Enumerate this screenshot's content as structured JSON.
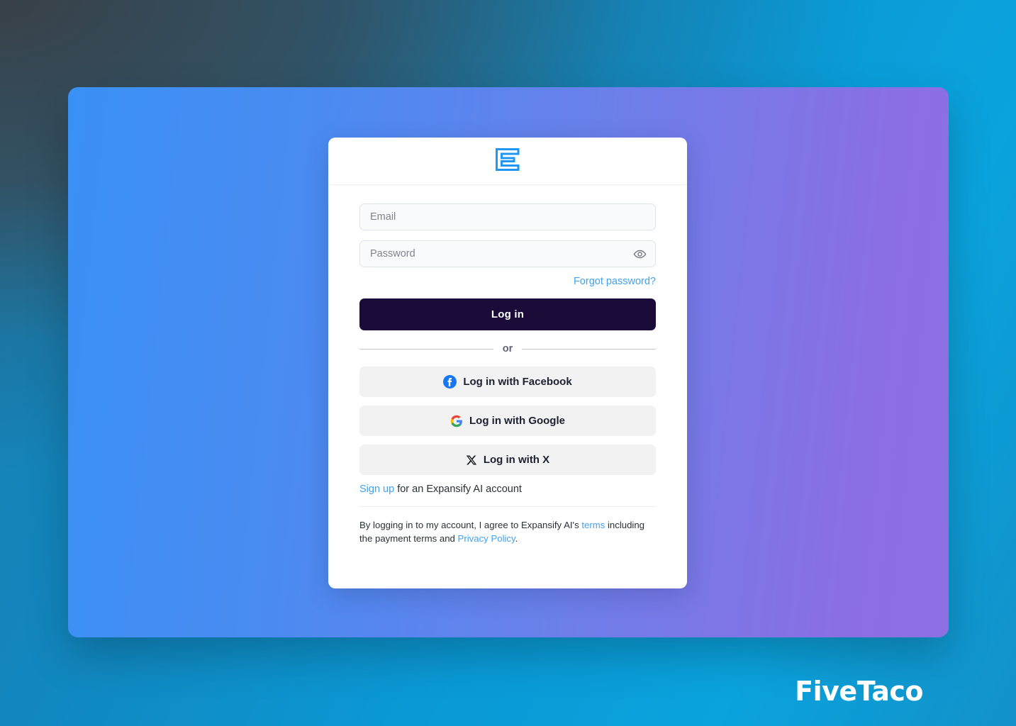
{
  "background": {
    "gradient_start": "#1b7fae",
    "gradient_end": "#0aa3dd",
    "overlay_dark": "#3a3e44"
  },
  "panel": {
    "gradient_start": "#3a91f5",
    "gradient_end": "#8d6fe2"
  },
  "card": {
    "logo_name": "expansify-e-logo",
    "logo_color": "#2196f3"
  },
  "form": {
    "email": {
      "placeholder": "Email",
      "value": ""
    },
    "password": {
      "placeholder": "Password",
      "value": "",
      "toggle_icon": "eye-icon"
    },
    "forgot_password_label": "Forgot password?",
    "login_button_label": "Log in",
    "login_button_color": "#1a0b38"
  },
  "divider": {
    "or_label": "or"
  },
  "social": {
    "buttons": [
      {
        "label": "Log in with Facebook",
        "icon": "facebook-icon",
        "color": "#1877f2"
      },
      {
        "label": "Log in with Google",
        "icon": "google-icon",
        "color": "#4285f4"
      },
      {
        "label": "Log in with X",
        "icon": "x-twitter-icon",
        "color": "#14171a"
      }
    ]
  },
  "signup": {
    "link_label": "Sign up",
    "rest_text": " for an Expansify AI account"
  },
  "legal": {
    "part1": "By logging in to my account, I agree to Expansify AI's ",
    "terms_label": "terms",
    "part2": " including the payment terms and ",
    "privacy_label": "Privacy Policy",
    "part3": "."
  },
  "watermark": {
    "text": "FiveTaco"
  }
}
